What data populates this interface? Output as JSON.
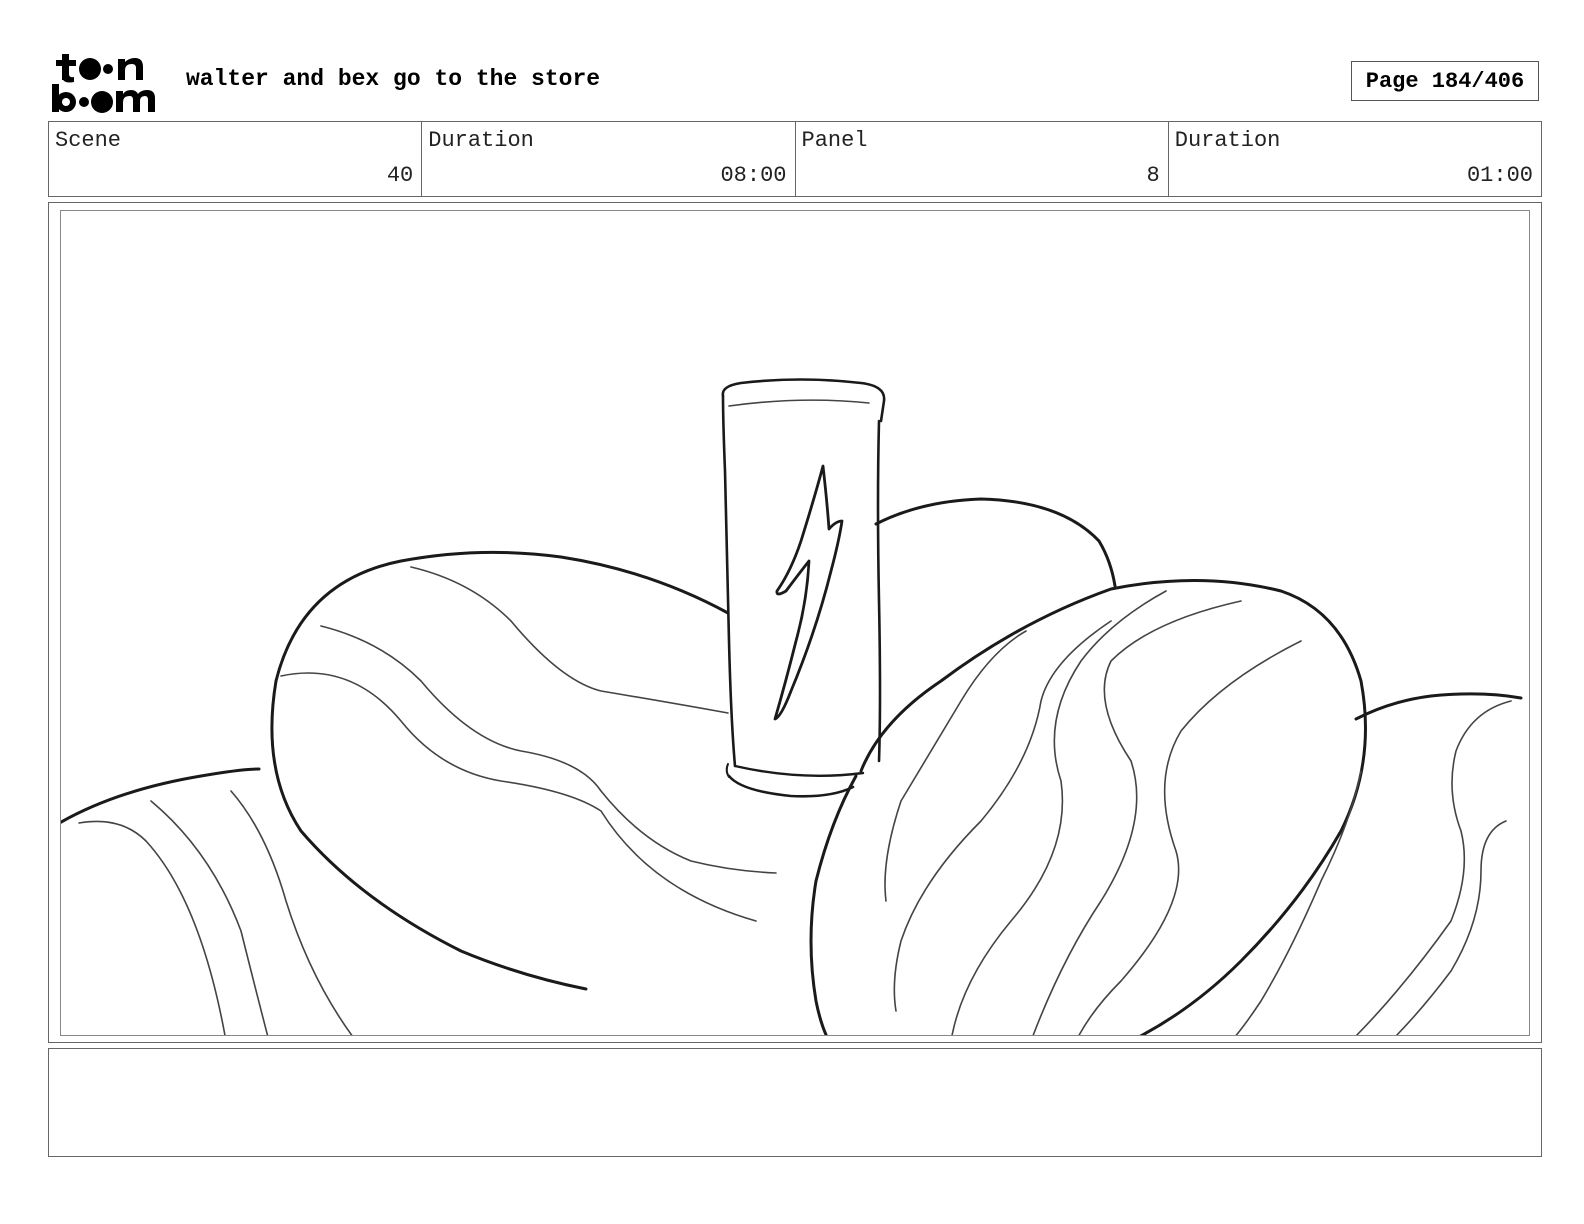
{
  "header": {
    "logo_text": "toon boom",
    "project_title": "walter and bex go to the store",
    "page_label": "Page 184/406"
  },
  "info": {
    "scene_label": "Scene",
    "scene_value": "40",
    "scene_duration_label": "Duration",
    "scene_duration_value": "08:00",
    "panel_label": "Panel",
    "panel_value": "8",
    "panel_duration_label": "Duration",
    "panel_duration_value": "01:00"
  },
  "notes": {
    "text": ""
  }
}
